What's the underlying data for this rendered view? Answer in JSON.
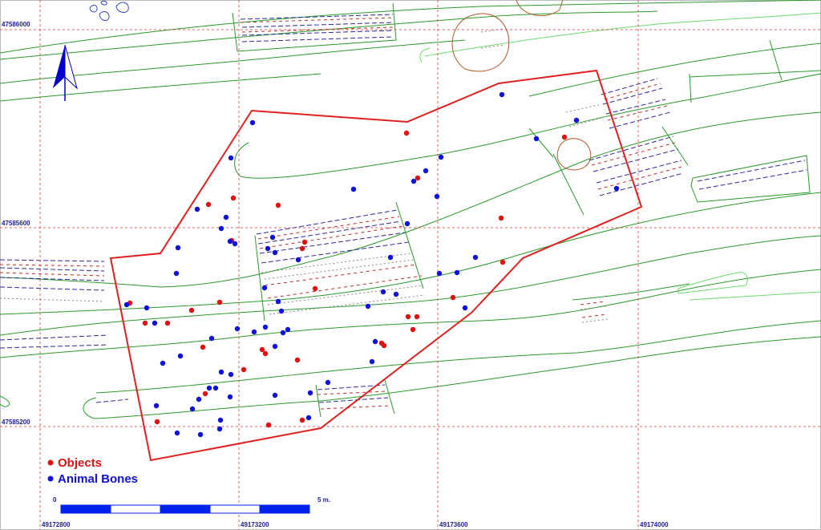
{
  "map": {
    "colors": {
      "grid": "#d83a3a",
      "excavation_outline": "#e02020",
      "contour": "#2a9a2a",
      "contour_light": "#6ddc6d",
      "hatch_red": "#c03030",
      "hatch_blue": "#2a2aa0",
      "pit": "#b05a2a",
      "objects": "#e01010",
      "animal_bones": "#1010dd",
      "scale_fill": "#0022ee",
      "north_arrow": "#0000cc"
    },
    "coordinates": {
      "northing": [
        "47586000",
        "47585600",
        "47585200"
      ],
      "easting": [
        "49172800",
        "49173200",
        "49173600",
        "49174000"
      ]
    },
    "legend": {
      "objects_label": "Objects",
      "animal_bones_label": "Animal Bones"
    },
    "scale_bar": {
      "start_label": "0",
      "end_label": "5 m.",
      "segments": 5
    },
    "north_arrow_icon": "north-arrow-icon",
    "finds": {
      "objects": [
        [
          507,
          166
        ],
        [
          704,
          171
        ],
        [
          521,
          222
        ],
        [
          291,
          247
        ],
        [
          260,
          255
        ],
        [
          347,
          256
        ],
        [
          625,
          272
        ],
        [
          289,
          300
        ],
        [
          380,
          302
        ],
        [
          377,
          310
        ],
        [
          627,
          327
        ],
        [
          393,
          360
        ],
        [
          565,
          371
        ],
        [
          162,
          378
        ],
        [
          274,
          377
        ],
        [
          239,
          387
        ],
        [
          181,
          403
        ],
        [
          209,
          403
        ],
        [
          509,
          395
        ],
        [
          520,
          395
        ],
        [
          515,
          411
        ],
        [
          476,
          428
        ],
        [
          479,
          431
        ],
        [
          253,
          433
        ],
        [
          327,
          436
        ],
        [
          331,
          441
        ],
        [
          371,
          449
        ],
        [
          304,
          461
        ],
        [
          256,
          491
        ],
        [
          196,
          526
        ],
        [
          335,
          530
        ],
        [
          377,
          524
        ]
      ],
      "animal_bones": [
        [
          315,
          153
        ],
        [
          626,
          118
        ],
        [
          719,
          150
        ],
        [
          669,
          173
        ],
        [
          550,
          196
        ],
        [
          288,
          197
        ],
        [
          531,
          213
        ],
        [
          516,
          226
        ],
        [
          441,
          236
        ],
        [
          545,
          245
        ],
        [
          769,
          235
        ],
        [
          246,
          261
        ],
        [
          282,
          271
        ],
        [
          276,
          285
        ],
        [
          508,
          279
        ],
        [
          287,
          301
        ],
        [
          293,
          304
        ],
        [
          222,
          309
        ],
        [
          340,
          296
        ],
        [
          334,
          310
        ],
        [
          343,
          315
        ],
        [
          593,
          321
        ],
        [
          372,
          324
        ],
        [
          487,
          321
        ],
        [
          570,
          340
        ],
        [
          548,
          341
        ],
        [
          220,
          341
        ],
        [
          330,
          359
        ],
        [
          478,
          364
        ],
        [
          494,
          367
        ],
        [
          347,
          376
        ],
        [
          459,
          382
        ],
        [
          580,
          384
        ],
        [
          158,
          380
        ],
        [
          183,
          384
        ],
        [
          193,
          403
        ],
        [
          351,
          388
        ],
        [
          359,
          411
        ],
        [
          353,
          415
        ],
        [
          331,
          408
        ],
        [
          296,
          410
        ],
        [
          317,
          414
        ],
        [
          264,
          422
        ],
        [
          343,
          432
        ],
        [
          468,
          426
        ],
        [
          225,
          444
        ],
        [
          203,
          453
        ],
        [
          464,
          451
        ],
        [
          288,
          467
        ],
        [
          276,
          464
        ],
        [
          409,
          477
        ],
        [
          269,
          484
        ],
        [
          261,
          484
        ],
        [
          287,
          495
        ],
        [
          248,
          498
        ],
        [
          343,
          493
        ],
        [
          387,
          490
        ],
        [
          195,
          506
        ],
        [
          275,
          524
        ],
        [
          385,
          521
        ],
        [
          274,
          535
        ],
        [
          221,
          540
        ],
        [
          250,
          542
        ],
        [
          240,
          510
        ]
      ]
    }
  }
}
